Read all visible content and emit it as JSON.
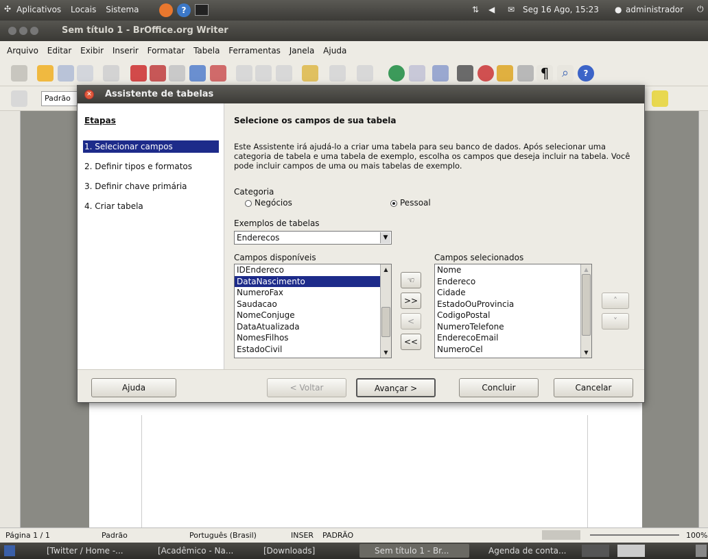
{
  "top_panel": {
    "menus": [
      "Aplicativos",
      "Locais",
      "Sistema"
    ],
    "clock": "Seg 16 Ago, 15:23",
    "user": "administrador"
  },
  "window": {
    "title": "Sem título 1 - BrOffice.org Writer"
  },
  "menubar": [
    "Arquivo",
    "Editar",
    "Exibir",
    "Inserir",
    "Formatar",
    "Tabela",
    "Ferramentas",
    "Janela",
    "Ajuda"
  ],
  "toolbar2": {
    "style": "Padrão"
  },
  "dialog": {
    "title": "Assistente de tabelas",
    "steps_header": "Etapas",
    "steps": [
      "1. Selecionar campos",
      "2. Definir tipos e formatos",
      "3. Definir chave primária",
      "4. Criar tabela"
    ],
    "heading": "Selecione os campos de sua tabela",
    "description": "Este Assistente irá ajudá-lo a criar uma tabela para seu banco de dados. Após selecionar uma categoria de tabela e uma tabela de exemplo, escolha os campos que deseja incluir na tabela. Você pode incluir campos de uma ou mais tabelas de exemplo.",
    "category_label": "Categoria",
    "radio_business": "Negócios",
    "radio_personal": "Pessoal",
    "examples_label": "Exemplos de tabelas",
    "examples_value": "Enderecos",
    "available_label": "Campos disponíveis",
    "available_fields": [
      "IDEndereco",
      "DataNascimento",
      "NumeroFax",
      "Saudacao",
      "NomeConjuge",
      "DataAtualizada",
      "NomesFilhos",
      "EstadoCivil"
    ],
    "selected_label": "Campos selecionados",
    "selected_fields": [
      "Nome",
      "Endereco",
      "Cidade",
      "EstadoOuProvincia",
      "CodigoPostal",
      "NumeroTelefone",
      "EnderecoEmail",
      "NumeroCel"
    ],
    "move_add_all": ">>",
    "move_remove": "<",
    "move_remove_all": "<<",
    "buttons": {
      "help": "Ajuda",
      "back": "< Voltar",
      "next": "Avançar >",
      "finish": "Concluir",
      "cancel": "Cancelar"
    }
  },
  "statusbar": {
    "page": "Página 1 / 1",
    "style": "Padrão",
    "language": "Português (Brasil)",
    "insert": "INSER",
    "mode": "PADRÃO",
    "zoom": "100%"
  },
  "taskbar": [
    "[Twitter / Home -...",
    "[Acadêmico - Na...",
    "[Downloads]",
    "Sem título 1 - Br...",
    "Agenda de conta..."
  ]
}
